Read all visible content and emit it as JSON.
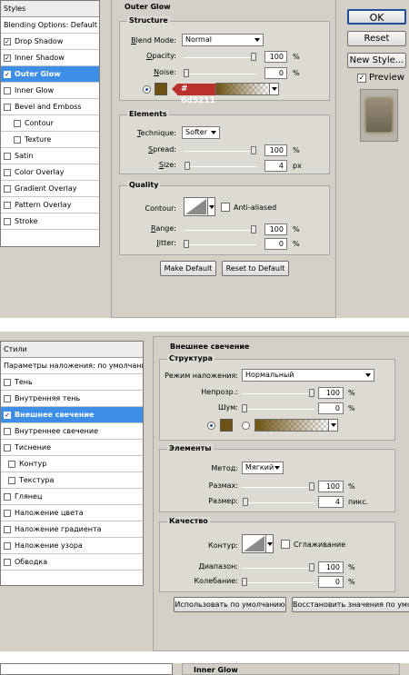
{
  "colors": {
    "selection": "#3d8ee6",
    "glow": "#6d5211",
    "tag": "#b9312a",
    "panel": "#d4d0c8"
  },
  "p1": {
    "styles_items": [
      {
        "label": "Styles",
        "checkbox": false,
        "checked": false,
        "selected": false
      },
      {
        "label": "Blending Options: Default",
        "checkbox": false,
        "checked": false,
        "selected": false
      },
      {
        "label": "Drop Shadow",
        "checkbox": true,
        "checked": true,
        "selected": false
      },
      {
        "label": "Inner Shadow",
        "checkbox": true,
        "checked": true,
        "selected": false
      },
      {
        "label": "Outer Glow",
        "checkbox": true,
        "checked": true,
        "selected": true
      },
      {
        "label": "Inner Glow",
        "checkbox": true,
        "checked": false,
        "selected": false
      },
      {
        "label": "Bevel and Emboss",
        "checkbox": true,
        "checked": false,
        "selected": false
      },
      {
        "label": "Contour",
        "checkbox": true,
        "checked": false,
        "selected": false,
        "indent": true
      },
      {
        "label": "Texture",
        "checkbox": true,
        "checked": false,
        "selected": false,
        "indent": true
      },
      {
        "label": "Satin",
        "checkbox": true,
        "checked": false,
        "selected": false
      },
      {
        "label": "Color Overlay",
        "checkbox": true,
        "checked": false,
        "selected": false
      },
      {
        "label": "Gradient Overlay",
        "checkbox": true,
        "checked": false,
        "selected": false
      },
      {
        "label": "Pattern Overlay",
        "checkbox": true,
        "checked": false,
        "selected": false
      },
      {
        "label": "Stroke",
        "checkbox": true,
        "checked": false,
        "selected": false
      }
    ],
    "title": "Outer Glow",
    "structure": {
      "title": "Structure",
      "blend_label": "Blend Mode:",
      "blend_value": "Normal",
      "opacity_label": "Opacity:",
      "opacity_value": "100",
      "opacity_level": 1.0,
      "noise_label": "Noise:",
      "noise_value": "0",
      "noise_level": 0,
      "pct": "%",
      "color_tag": "# 6d5211"
    },
    "elements": {
      "title": "Elements",
      "technique_label": "Technique:",
      "technique_value": "Softer",
      "spread_label": "Spread:",
      "spread_value": "100",
      "spread_level": 1.0,
      "size_label": "Size:",
      "size_value": "4",
      "size_level": 0.02,
      "pct": "%",
      "px": "px"
    },
    "quality": {
      "title": "Quality",
      "contour_label": "Contour:",
      "anti_aliased": "Anti-aliased",
      "range_label": "Range:",
      "range_value": "100",
      "range_level": 1.0,
      "jitter_label": "Jitter:",
      "jitter_value": "0",
      "jitter_level": 0,
      "pct": "%"
    },
    "buttons": {
      "make_default": "Make Default",
      "reset_default": "Reset to Default"
    },
    "side": {
      "ok": "OK",
      "reset": "Reset",
      "new_style": "New Style...",
      "preview": "Preview"
    }
  },
  "p2": {
    "styles_items": [
      {
        "label": "Стили",
        "checkbox": false,
        "checked": false,
        "selected": false
      },
      {
        "label": "Параметры наложения: по умолчанию",
        "checkbox": false,
        "checked": false,
        "selected": false
      },
      {
        "label": "Тень",
        "checkbox": true,
        "checked": false,
        "selected": false
      },
      {
        "label": "Внутренняя тень",
        "checkbox": true,
        "checked": false,
        "selected": false
      },
      {
        "label": "Внешнее свечение",
        "checkbox": true,
        "checked": true,
        "selected": true
      },
      {
        "label": "Внутреннее свечение",
        "checkbox": true,
        "checked": false,
        "selected": false
      },
      {
        "label": "Тиснение",
        "checkbox": true,
        "checked": false,
        "selected": false
      },
      {
        "label": "Контур",
        "checkbox": true,
        "checked": false,
        "selected": false,
        "indent": true
      },
      {
        "label": "Текстура",
        "checkbox": true,
        "checked": false,
        "selected": false,
        "indent": true
      },
      {
        "label": "Глянец",
        "checkbox": true,
        "checked": false,
        "selected": false
      },
      {
        "label": "Наложение цвета",
        "checkbox": true,
        "checked": false,
        "selected": false
      },
      {
        "label": "Наложение градиента",
        "checkbox": true,
        "checked": false,
        "selected": false
      },
      {
        "label": "Наложение узора",
        "checkbox": true,
        "checked": false,
        "selected": false
      },
      {
        "label": "Обводка",
        "checkbox": true,
        "checked": false,
        "selected": false
      }
    ],
    "title": "Внешнее свечение",
    "structure": {
      "title": "Структура",
      "blend_label": "Режим наложения:",
      "blend_value": "Нормальный",
      "opacity_label": "Непрозр.:",
      "opacity_value": "100",
      "opacity_level": 1.0,
      "noise_label": "Шум:",
      "noise_value": "0",
      "noise_level": 0,
      "pct": "%"
    },
    "elements": {
      "title": "Элементы",
      "technique_label": "Метод:",
      "technique_value": "Мягкий",
      "spread_label": "Размах:",
      "spread_value": "100",
      "spread_level": 1.0,
      "size_label": "Размер:",
      "size_value": "4",
      "size_level": 0.02,
      "pct": "%",
      "px": "пикс."
    },
    "quality": {
      "title": "Качество",
      "contour_label": "Контур:",
      "anti_aliased": "Сглаживание",
      "range_label": "Диапазон:",
      "range_value": "100",
      "range_level": 1.0,
      "jitter_label": "Колебание:",
      "jitter_value": "0",
      "jitter_level": 0,
      "pct": "%"
    },
    "buttons": {
      "make_default": "Использовать по умолчанию",
      "reset_default": "Восстановить значения по умолчанию"
    }
  },
  "p3": {
    "title": "Inner Glow"
  }
}
